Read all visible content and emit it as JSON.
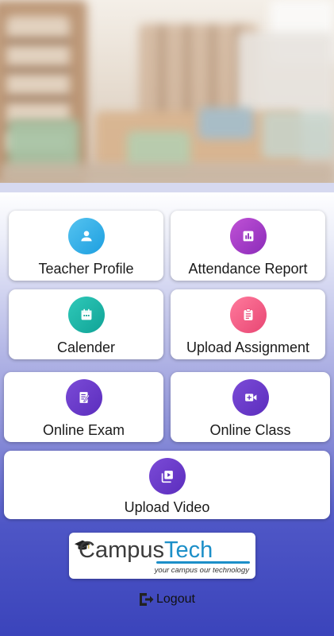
{
  "tiles": [
    {
      "label": "Teacher Profile",
      "icon": "person-icon",
      "color": "#1d9fe0"
    },
    {
      "label": "Attendance Report",
      "icon": "bar-chart-icon",
      "color": "#8b2bb9"
    },
    {
      "label": "Calender",
      "icon": "calendar-icon",
      "color": "#10a396"
    },
    {
      "label": "Upload Assignment",
      "icon": "clipboard-icon",
      "color": "#e84673"
    },
    {
      "label": "Online Exam",
      "icon": "exam-paper-icon",
      "color": "#5b2dbd"
    },
    {
      "label": "Online Class",
      "icon": "video-camera-icon",
      "color": "#5b2dbd"
    },
    {
      "label": "Upload Video",
      "icon": "video-library-icon",
      "color": "#5b2dbd"
    }
  ],
  "logo": {
    "word_part1": "Campus",
    "word_part2": "Tech",
    "tagline": "your campus our technology"
  },
  "logout": {
    "label": "Logout",
    "icon": "logout-icon"
  }
}
